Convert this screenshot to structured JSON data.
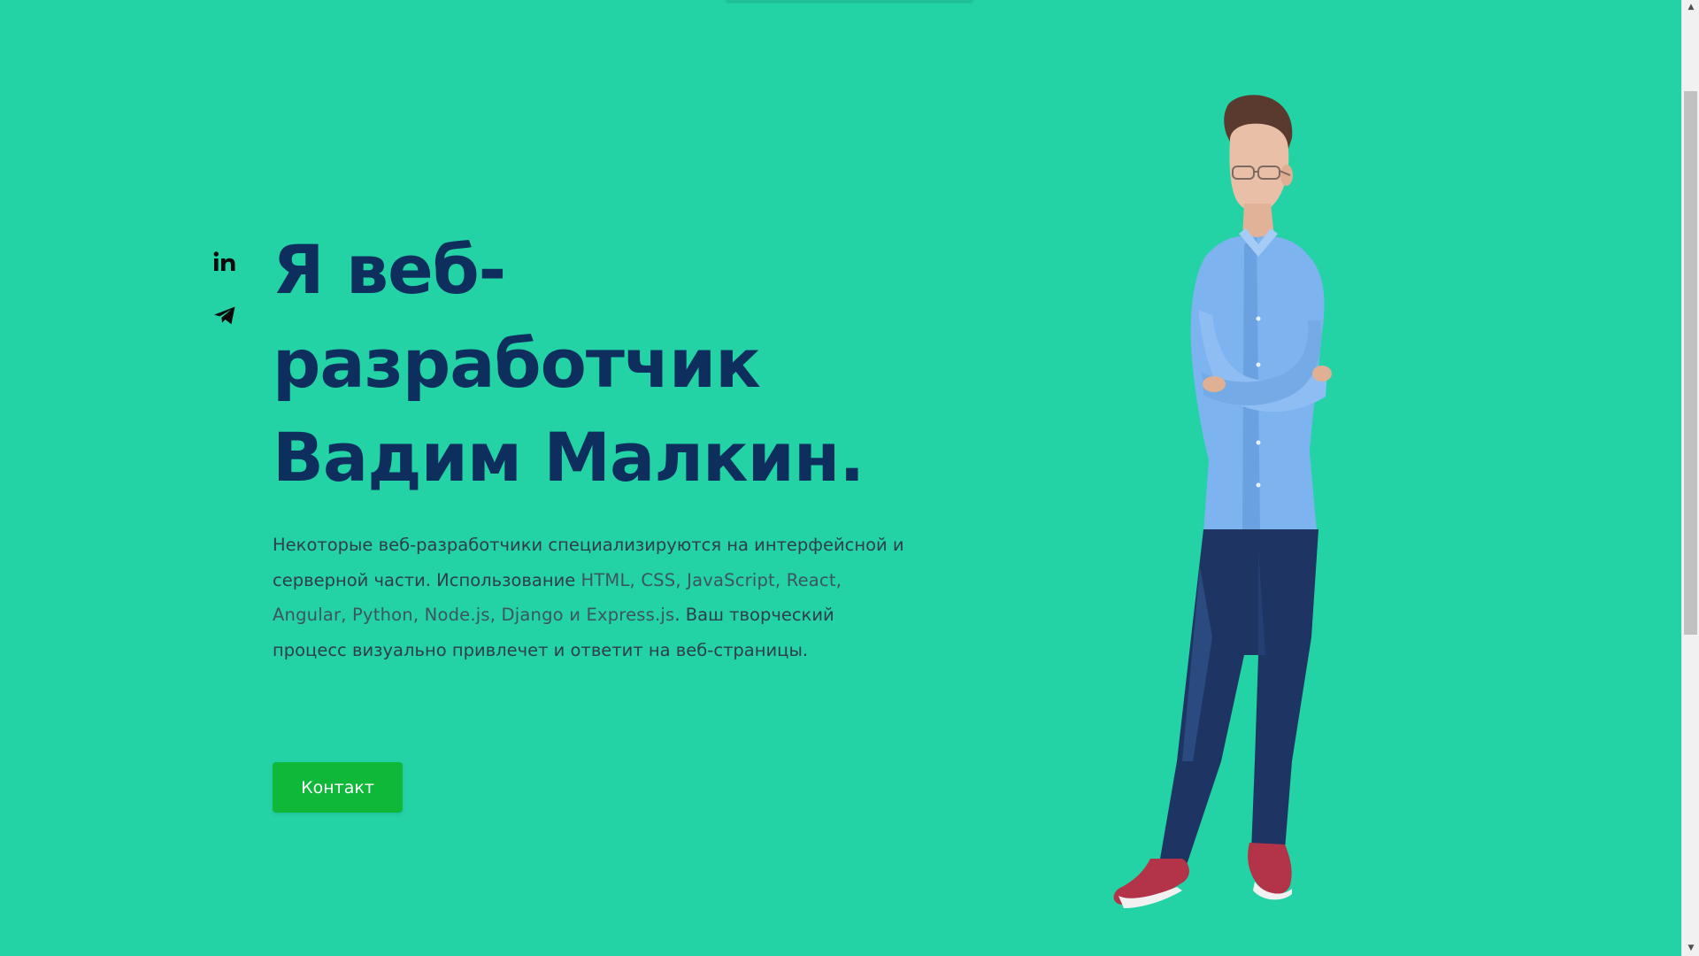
{
  "social": {
    "items": [
      {
        "name": "linkedin",
        "icon": "linkedin-icon"
      },
      {
        "name": "telegram",
        "icon": "telegram-icon"
      }
    ]
  },
  "hero": {
    "title_line1": "Я веб-",
    "title_line2": "разработчик",
    "title_line3": "Вадим Малкин.",
    "desc_part1": "Некоторые веб-разработчики специализируются на интерфейсной и серверной части. Использование ",
    "tech_html": "HTML",
    "sep1": ", ",
    "tech_css": "CSS",
    "sep2": ", ",
    "tech_js": "JavaScript",
    "sep3": ", ",
    "tech_react": "React",
    "sep4": ", ",
    "tech_angular": "Angular",
    "sep5": ", ",
    "tech_python": "Python",
    "sep6": ", ",
    "tech_node": "Node.js",
    "sep7": ", ",
    "tech_django": "Django",
    "sep8": " и ",
    "tech_express": "Express.js",
    "desc_part2": ". Ваш творческий процесс визуально привлечет и ответит на веб-страницы.",
    "contact_label": "Контакт"
  },
  "colors": {
    "background": "#23d2a5",
    "title": "#0e2f5e",
    "button": "#10b83a"
  },
  "scrollbar": {
    "up_arrow": "▲",
    "down_arrow": "▼"
  }
}
